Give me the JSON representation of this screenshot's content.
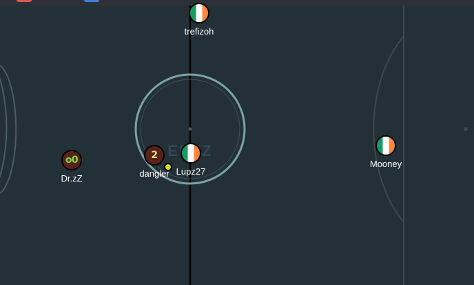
{
  "game": {
    "field_color": "#243038",
    "line_color": "#c8d7d8",
    "team_red_color": "#5a211b",
    "flag_colors": [
      "#169b62",
      "#ffffff",
      "#ff883e"
    ],
    "ball_color": "#d9dd2c",
    "top_tabs": [
      {
        "name": "red-tab",
        "color": "#e0574f"
      },
      {
        "name": "blue-tab",
        "color": "#3f82d6"
      }
    ],
    "players": [
      {
        "id": "trefizoh",
        "name": "trefizoh",
        "team": "blue",
        "avatar": "",
        "style": "flag"
      },
      {
        "id": "drzz",
        "name": "Dr.zZ",
        "team": "red",
        "avatar": "o0",
        "style": "red"
      },
      {
        "id": "dangler",
        "name": "dangler",
        "team": "red",
        "avatar": "2",
        "style": "red"
      },
      {
        "id": "lupz27",
        "name": "Lupz27",
        "team": "blue",
        "avatar": "",
        "style": "flag"
      },
      {
        "id": "mooney",
        "name": "Mooney",
        "team": "blue",
        "avatar": "",
        "style": "flag"
      }
    ],
    "center_logo": "EBTZ"
  }
}
